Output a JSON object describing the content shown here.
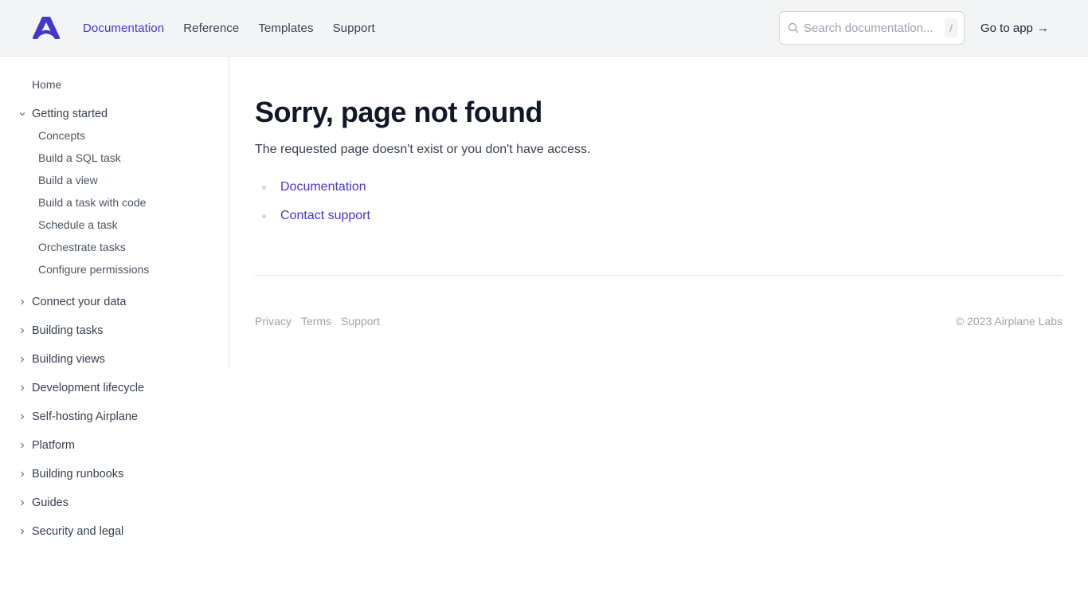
{
  "header": {
    "logo_alt": "Airplane",
    "nav": [
      {
        "label": "Documentation",
        "active": true
      },
      {
        "label": "Reference",
        "active": false
      },
      {
        "label": "Templates",
        "active": false
      },
      {
        "label": "Support",
        "active": false
      }
    ],
    "search": {
      "placeholder": "Search documentation...",
      "shortcut": "/"
    },
    "go_to_app": {
      "label": "Go to app",
      "arrow": "→"
    }
  },
  "sidebar": {
    "home": "Home",
    "sections": [
      {
        "label": "Getting started",
        "expanded": true,
        "items": [
          "Concepts",
          "Build a SQL task",
          "Build a view",
          "Build a task with code",
          "Schedule a task",
          "Orchestrate tasks",
          "Configure permissions"
        ]
      },
      {
        "label": "Connect your data",
        "expanded": false
      },
      {
        "label": "Building tasks",
        "expanded": false
      },
      {
        "label": "Building views",
        "expanded": false
      },
      {
        "label": "Development lifecycle",
        "expanded": false
      },
      {
        "label": "Self-hosting Airplane",
        "expanded": false
      },
      {
        "label": "Platform",
        "expanded": false
      },
      {
        "label": "Building runbooks",
        "expanded": false
      },
      {
        "label": "Guides",
        "expanded": false
      },
      {
        "label": "Security and legal",
        "expanded": false
      }
    ]
  },
  "main": {
    "title": "Sorry, page not found",
    "description": "The requested page doesn't exist or you don't have access.",
    "links": [
      "Documentation",
      "Contact support"
    ]
  },
  "footer": {
    "links": [
      "Privacy",
      "Terms",
      "Support"
    ],
    "copyright": "© 2023 Airplane Labs"
  },
  "colors": {
    "accent": "#4338ca",
    "header_bg": "#f3f4f6",
    "border": "#e5e7eb",
    "title": "#111827",
    "muted": "#9ca3af"
  }
}
